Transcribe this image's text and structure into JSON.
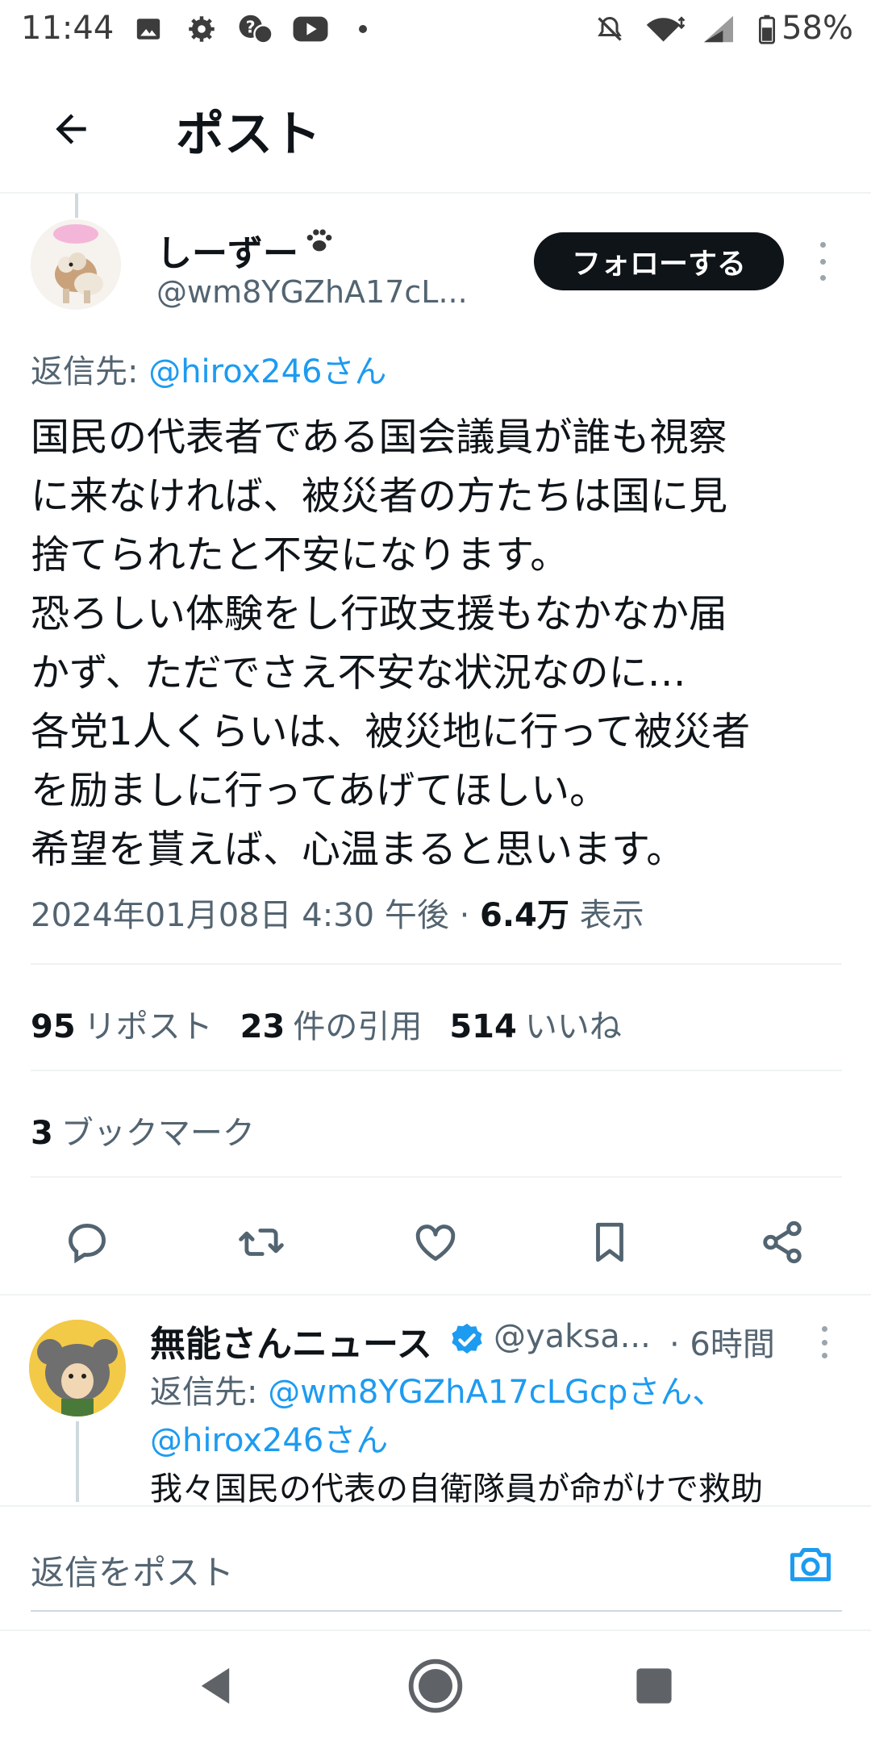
{
  "status_bar": {
    "time": "11:44",
    "battery": "58%"
  },
  "header": {
    "title": "ポスト"
  },
  "post": {
    "display_name": "しーずー",
    "handle": "@wm8YGZhA17cL...",
    "follow_label": "フォローする",
    "reply_to_prefix": "返信先: ",
    "reply_to_handle": "@hirox246さん",
    "text": "国民の代表者である国会議員が誰も視察\nに来なければ、被災者の方たちは国に見\n捨てられたと不安になります。\n恐ろしい体験をし行政支援もなかなか届\nかず、ただでさえ不安な状況なのに…\n各党1人くらいは、被災地に行って被災者\nを励ましに行ってあげてほしい。\n希望を貰えば、心温まると思います。",
    "timestamp": "2024年01月08日 4:30 午後",
    "views_count": "6.4万",
    "views_label": "表示",
    "reposts_count": "95",
    "reposts_label": "リポスト",
    "quotes_count": "23",
    "quotes_label": "件の引用",
    "likes_count": "514",
    "likes_label": "いいね",
    "bookmarks_count": "3",
    "bookmarks_label": "ブックマーク",
    "accent_color": "#1d9bf0"
  },
  "reply": {
    "display_name": "無能さんニュース",
    "handle": "@yaksa...",
    "time": "· 6時間",
    "reply_to_prefix": "返信先: ",
    "reply_to_handle_1": "@wm8YGZhA17cLGcpさん、",
    "reply_to_handle_2": "@hirox246さん",
    "text": "我々国民の代表の自衛隊員が命がけで救助"
  },
  "composer": {
    "placeholder": "返信をポスト"
  },
  "icons": {
    "back": "arrow-left-icon",
    "more": "more-vert-icon",
    "reply": "reply-icon",
    "repost": "repost-icon",
    "like": "heart-icon",
    "bookmark": "bookmark-icon",
    "share": "share-icon",
    "camera": "camera-icon",
    "verified": "verified-badge-icon"
  }
}
